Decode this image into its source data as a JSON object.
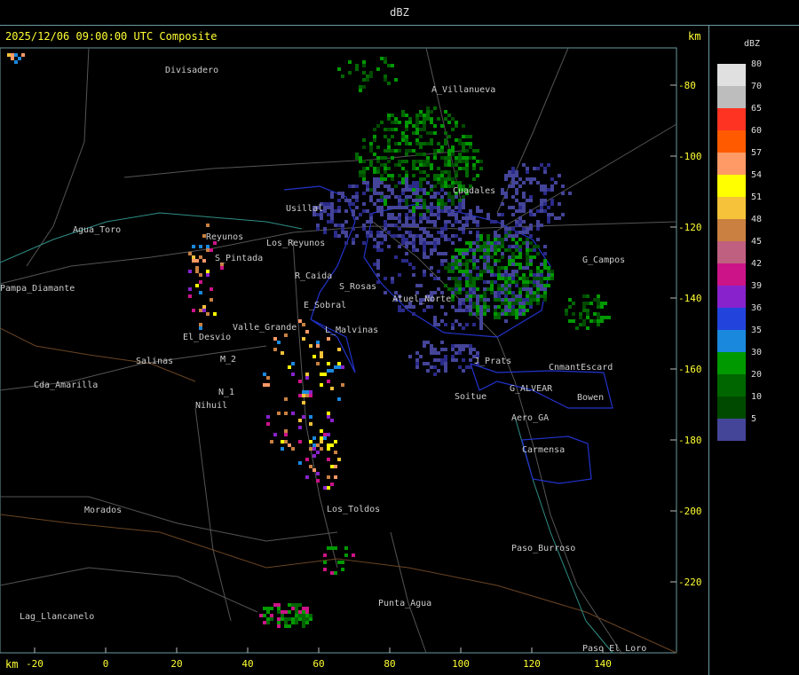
{
  "title": "dBZ",
  "header": "2025/12/06 09:00:00 UTC Composite",
  "km_top": "km",
  "km_bottom": "km",
  "legend": {
    "title": "dBZ",
    "entries": [
      {
        "label": "80",
        "color": "#e0e0e0"
      },
      {
        "label": "70",
        "color": "#bdbdbd"
      },
      {
        "label": "65",
        "color": "#ff3322"
      },
      {
        "label": "60",
        "color": "#ff5a00"
      },
      {
        "label": "57",
        "color": "#ff9966"
      },
      {
        "label": "54",
        "color": "#ffff00"
      },
      {
        "label": "51",
        "color": "#f6c23a"
      },
      {
        "label": "48",
        "color": "#c98040"
      },
      {
        "label": "45",
        "color": "#c06080"
      },
      {
        "label": "42",
        "color": "#cc1488"
      },
      {
        "label": "39",
        "color": "#8822cc"
      },
      {
        "label": "36",
        "color": "#2244dd"
      },
      {
        "label": "35",
        "color": "#1a88dd"
      },
      {
        "label": "30",
        "color": "#009900"
      },
      {
        "label": "20",
        "color": "#006600"
      },
      {
        "label": "10",
        "color": "#004a00"
      },
      {
        "label": "5",
        "color": "#444499"
      }
    ]
  },
  "y_ticks": [
    "-80",
    "-100",
    "-120",
    "-140",
    "-160",
    "-180",
    "-200",
    "-220"
  ],
  "x_ticks": [
    "-20",
    "0",
    "20",
    "40",
    "60",
    "80",
    "100",
    "120",
    "140"
  ],
  "places": [
    {
      "name": "Divisadero",
      "x": 186,
      "y": 82
    },
    {
      "name": "A_Villanueva",
      "x": 486,
      "y": 104
    },
    {
      "name": "Cuadales",
      "x": 510,
      "y": 218
    },
    {
      "name": "Usillal",
      "x": 322,
      "y": 238
    },
    {
      "name": "Agua_Toro",
      "x": 82,
      "y": 262
    },
    {
      "name": "Reyunos",
      "x": 232,
      "y": 270
    },
    {
      "name": "Los_Reyunos",
      "x": 300,
      "y": 277
    },
    {
      "name": "G_Campos",
      "x": 656,
      "y": 296
    },
    {
      "name": "S_Pintada",
      "x": 242,
      "y": 294
    },
    {
      "name": "R_Caida",
      "x": 332,
      "y": 314
    },
    {
      "name": "S_Rosas",
      "x": 382,
      "y": 326
    },
    {
      "name": "Pampa_Diamante",
      "x": 0,
      "y": 328
    },
    {
      "name": "Atuel_Norte",
      "x": 442,
      "y": 340
    },
    {
      "name": "E_Sobral",
      "x": 342,
      "y": 347
    },
    {
      "name": "Valle_Grande",
      "x": 262,
      "y": 372
    },
    {
      "name": "L_Malvinas",
      "x": 366,
      "y": 375
    },
    {
      "name": "El_Desvio",
      "x": 206,
      "y": 383
    },
    {
      "name": "M_2",
      "x": 248,
      "y": 408
    },
    {
      "name": "Salinas",
      "x": 153,
      "y": 410
    },
    {
      "name": "J_Prats",
      "x": 534,
      "y": 410
    },
    {
      "name": "CnmantEscard",
      "x": 618,
      "y": 417
    },
    {
      "name": "Cda_Amarilla",
      "x": 38,
      "y": 437
    },
    {
      "name": "G_ALVEAR",
      "x": 574,
      "y": 441
    },
    {
      "name": "N_1",
      "x": 246,
      "y": 445
    },
    {
      "name": "Soitue",
      "x": 512,
      "y": 450
    },
    {
      "name": "Bowen",
      "x": 650,
      "y": 451
    },
    {
      "name": "Nihuil",
      "x": 220,
      "y": 460
    },
    {
      "name": "Aero_GA",
      "x": 576,
      "y": 474
    },
    {
      "name": "Carmensa",
      "x": 588,
      "y": 510
    },
    {
      "name": "Morados",
      "x": 95,
      "y": 578
    },
    {
      "name": "Los_Toldos",
      "x": 368,
      "y": 577
    },
    {
      "name": "Paso_Burroso",
      "x": 576,
      "y": 621
    },
    {
      "name": "Punta_Agua",
      "x": 426,
      "y": 683
    },
    {
      "name": "Lag_Llancanelo",
      "x": 22,
      "y": 698
    },
    {
      "name": "Paso_El_Loro",
      "x": 656,
      "y": 734
    }
  ]
}
